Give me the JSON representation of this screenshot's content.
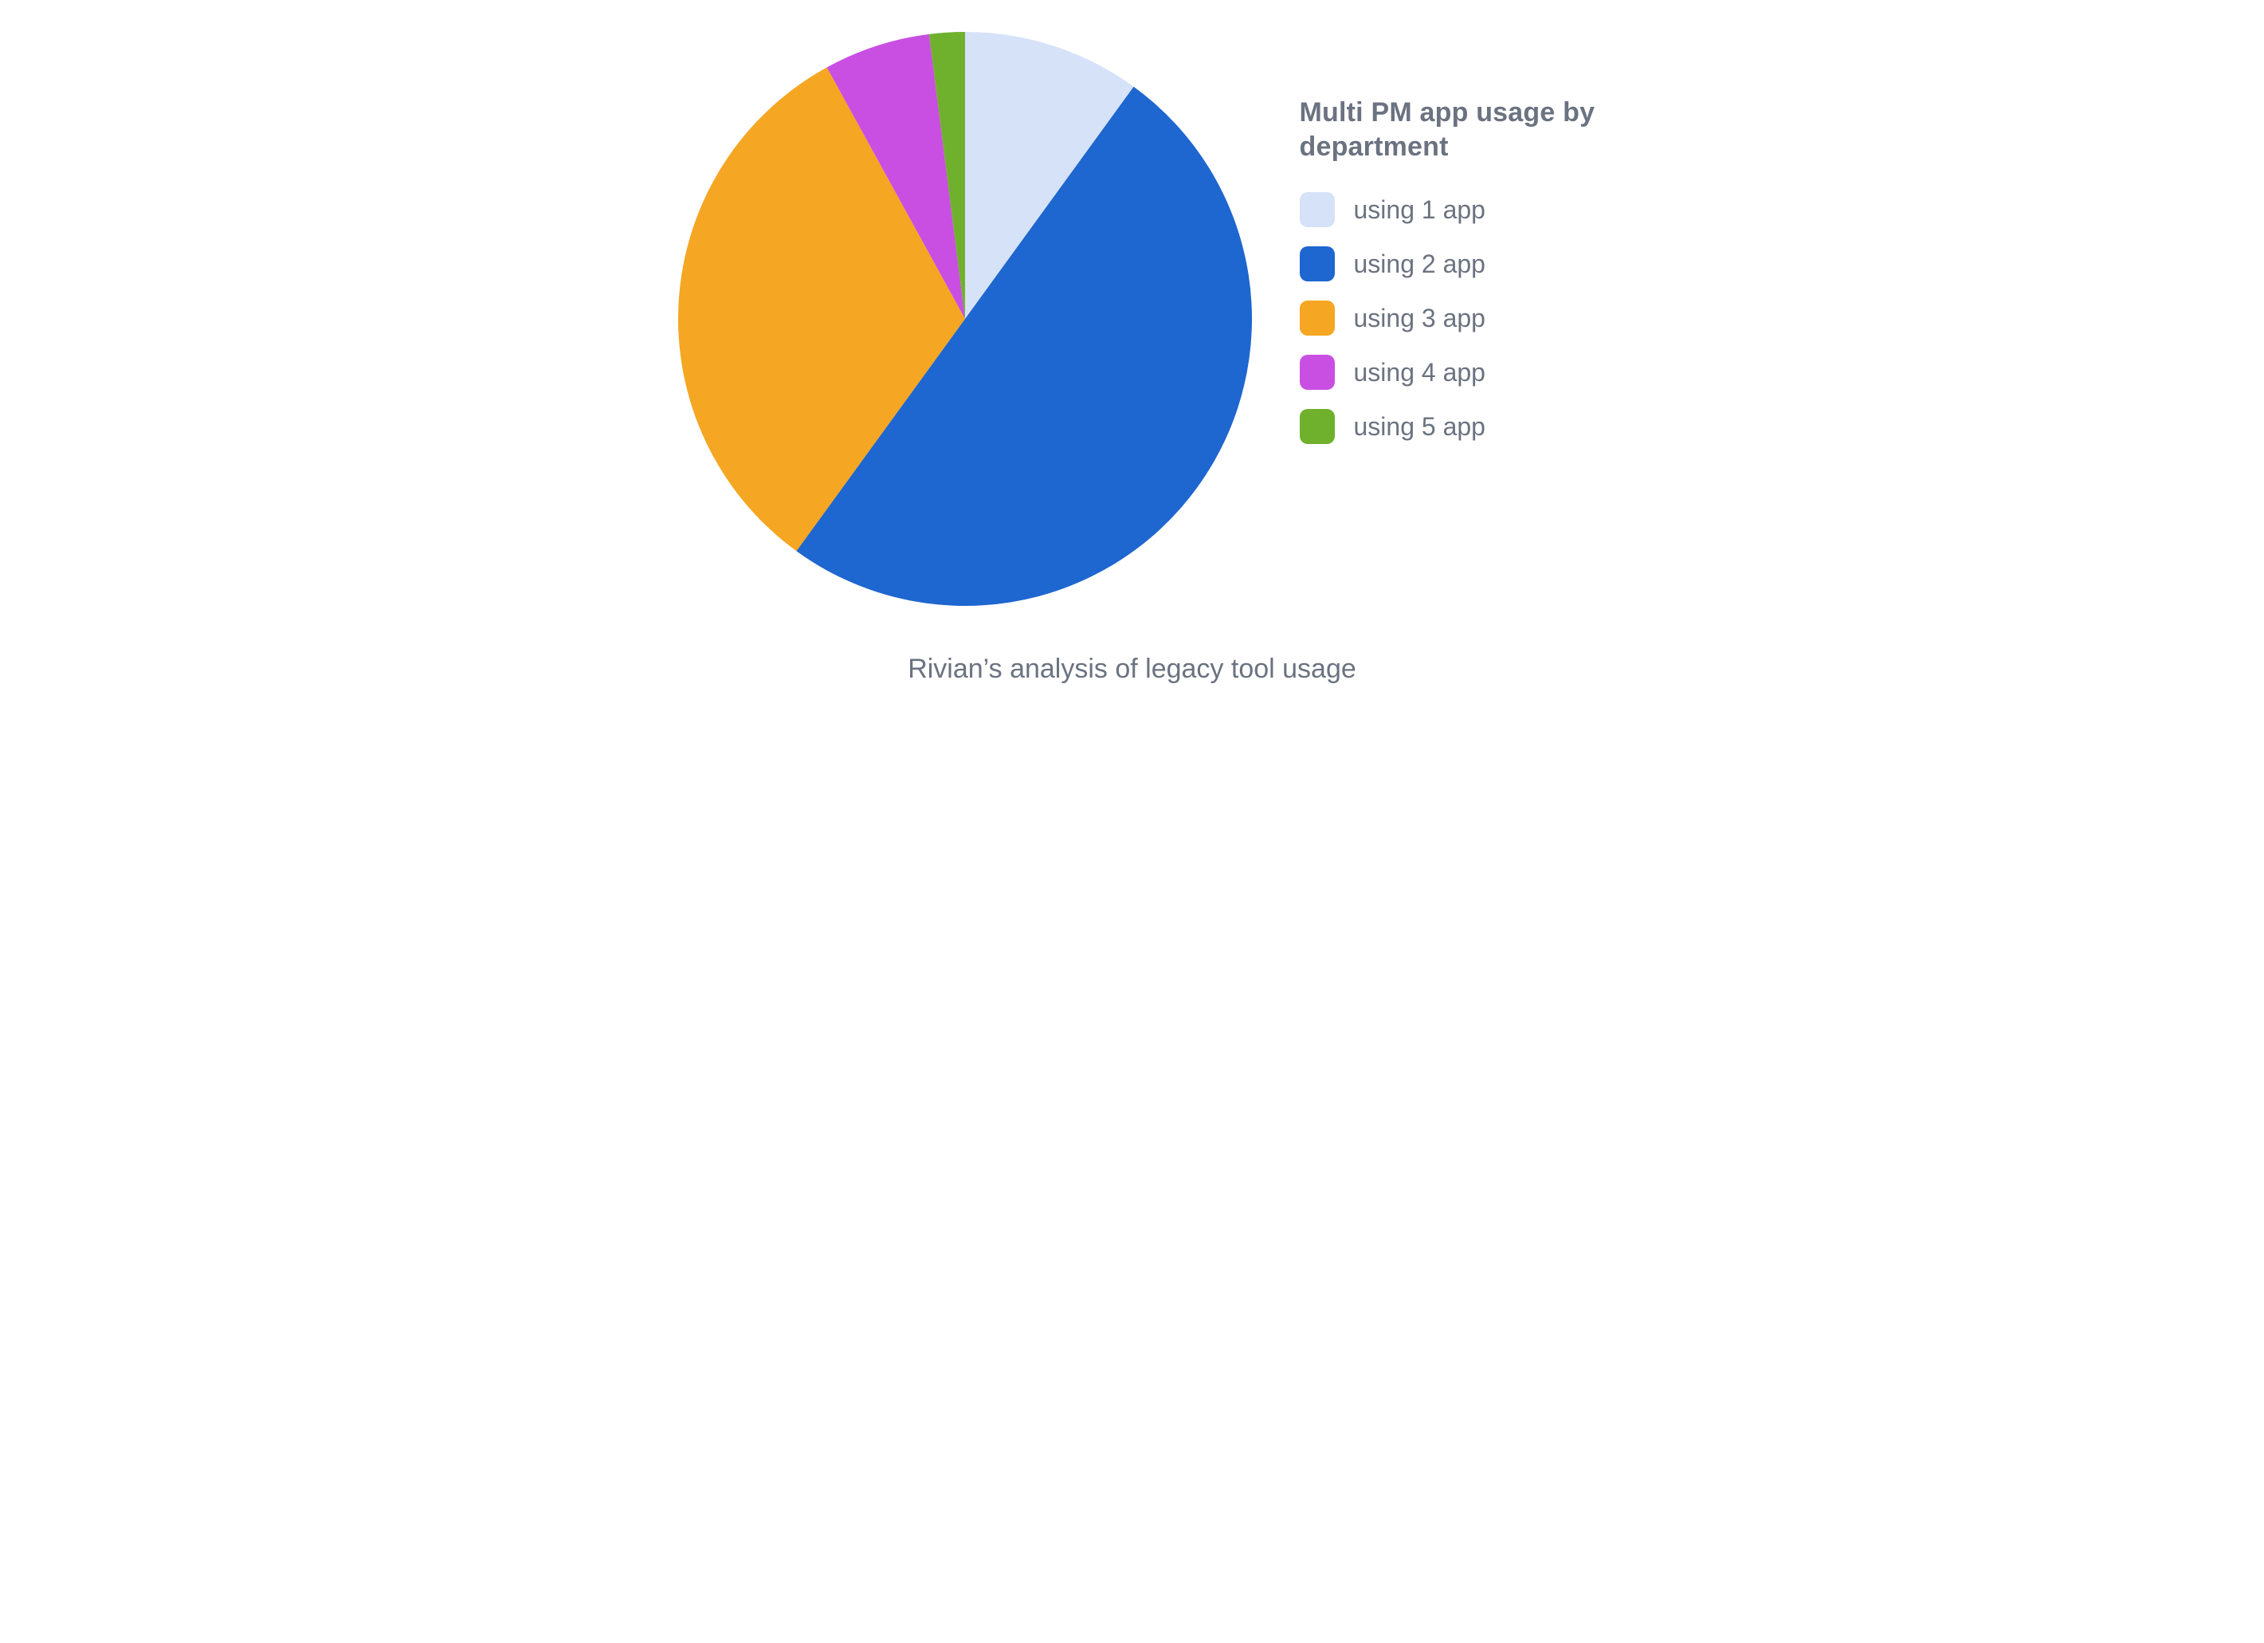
{
  "chart_data": {
    "type": "pie",
    "title": "Multi PM app usage by department",
    "caption": "Rivian’s analysis of legacy tool usage",
    "series": [
      {
        "name": "using 1 app",
        "value": 10,
        "color": "#d6e2f7"
      },
      {
        "name": "using 2 app",
        "value": 50,
        "color": "#1e66d0"
      },
      {
        "name": "using 3 app",
        "value": 32,
        "color": "#f5a623"
      },
      {
        "name": "using 4 app",
        "value": 6,
        "color": "#c94fe2"
      },
      {
        "name": "using 5 app",
        "value": 2,
        "color": "#6fb12c"
      }
    ],
    "legend_position": "right",
    "start_angle_deg": 0,
    "direction": "clockwise"
  }
}
